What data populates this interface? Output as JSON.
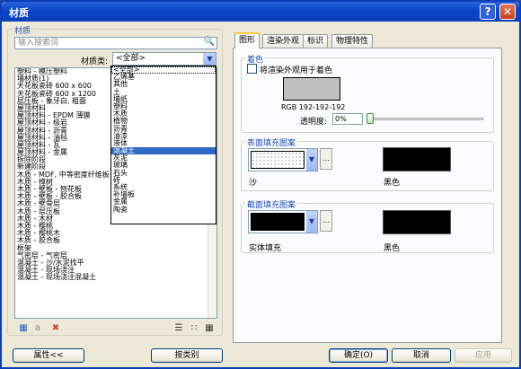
{
  "window": {
    "title": "材质",
    "help_glyph": "?",
    "close_glyph": "✕"
  },
  "left": {
    "group_label": "材质",
    "search_placeholder": "输入搜索词",
    "category_label": "材质类:",
    "category_value": "<全部>",
    "materials": [
      "塑料 - 模压塑料",
      "墙材质(1)",
      "天花板瓷砖 600 x 600",
      "天花板瓷砖 600 x 1200",
      "层压板 - 象牙白, 粗面",
      "屋顶材料",
      "屋顶材料 - EPDM 薄膜",
      "屋顶材料 - 极岩",
      "屋顶材料 - 沥青",
      "屋顶材料 - 油毡",
      "屋顶材料 - 瓦",
      "屋顶材料 - 金属",
      "拆除阶段",
      "新建阶段",
      "木质 - MDF, 中等密度纤维板",
      "木质 - 樟树",
      "木质 - 壁板 - 刨花板",
      "木质 - 壁板 - 胶合板",
      "木质 - 壁骨层",
      "木质 - 层压板",
      "木质 - 木材",
      "木质 - 樱桃",
      "木质 - 樱桃木",
      "木质 - 胶合板",
      "框架",
      "气密层 - 气密层",
      "混凝土 - 沙/水泥找平",
      "混凝土 - 现场浇注",
      "混凝土 - 现场浇注混凝土"
    ],
    "category_options": [
      "<全部>",
      "乙烯基",
      "其他",
      "土",
      "墙纸",
      "塑料",
      "木质",
      "植物",
      "沥青",
      "油漆",
      "液体",
      "混凝土",
      "灰泥",
      "玻璃",
      "石头",
      "砖",
      "系统",
      "补墙板",
      "金属",
      "陶瓷"
    ],
    "selected_option": "混凝土",
    "btn_properties": "属性<<",
    "btn_by_category": "按类别"
  },
  "tabs": [
    "图形",
    "渲染外观",
    "标识",
    "物理特性"
  ],
  "active_tab": "图形",
  "graphics": {
    "shading": {
      "label": "着色",
      "use_render_label": "将渲染外观用于着色",
      "use_render_checked": false,
      "color": "#c0c0c0",
      "rgb_text": "RGB 192-192-192",
      "transparency_label": "透明度:",
      "transparency_value": "0%"
    },
    "surface": {
      "label": "表面填充图案",
      "pattern_name": "沙",
      "color_name": "黑色",
      "color": "#000000"
    },
    "cut": {
      "label": "截面填充图案",
      "pattern_name": "实体填充",
      "color_name": "黑色",
      "color": "#000000"
    },
    "ellipsis": "..."
  },
  "footer": {
    "ok": "确定(O)",
    "cancel": "取消",
    "apply": "应用"
  },
  "icons": [
    "help-icon",
    "close-icon",
    "search-icon",
    "dropdown-arrow-icon",
    "new-material-icon",
    "rename-material-icon",
    "delete-material-icon",
    "list-view-icon",
    "small-icon-view-icon",
    "large-icon-view-icon"
  ]
}
